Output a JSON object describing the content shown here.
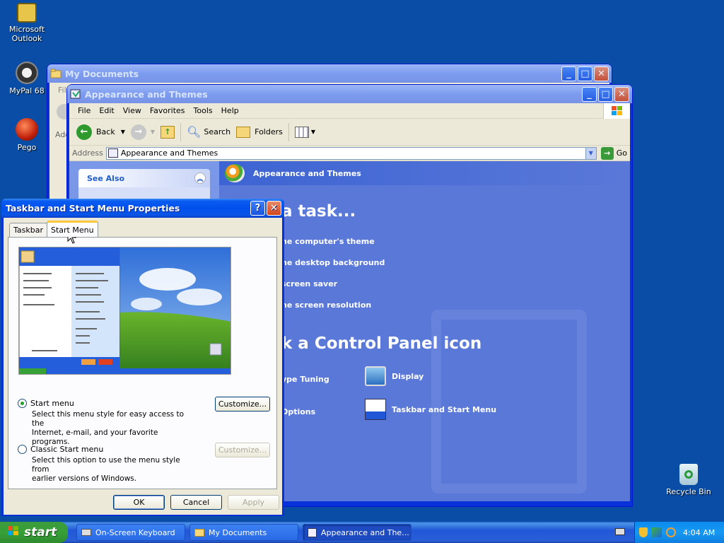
{
  "desktop": {
    "icons": [
      {
        "label_1": "Microsoft",
        "label_2": "Outlook"
      },
      {
        "label": "MyPal 68"
      },
      {
        "label": "Pego"
      },
      {
        "label": "Recycle Bin"
      }
    ]
  },
  "my_documents": {
    "title": "My Documents",
    "menu_partial": "File",
    "addr_partial": "Add"
  },
  "explorer": {
    "title": "Appearance and Themes",
    "menu": [
      "File",
      "Edit",
      "View",
      "Favorites",
      "Tools",
      "Help"
    ],
    "toolbar": {
      "back": "Back",
      "search": "Search",
      "folders": "Folders"
    },
    "address": {
      "label": "Address",
      "value": "Appearance and Themes",
      "go": "Go"
    },
    "see_also": "See Also",
    "header": "Appearance and Themes",
    "pick_task": "a task...",
    "tasks": [
      "he computer's theme",
      "he desktop background",
      " screen saver",
      "he screen resolution"
    ],
    "pick_icon": "k a Control Panel icon",
    "icons": [
      "ype Tuning",
      "Display",
      " Options",
      "Taskbar and Start Menu"
    ]
  },
  "dialog": {
    "title": "Taskbar and Start Menu Properties",
    "tabs": [
      "Taskbar",
      "Start Menu"
    ],
    "option1": {
      "label": "Start menu",
      "desc_1": "Select this menu style for easy access to the",
      "desc_2": "Internet, e-mail, and your favorite programs.",
      "button": "Customize...",
      "selected": true
    },
    "option2": {
      "label": "Classic Start menu",
      "desc_1": "Select this option to use the menu style from",
      "desc_2": "earlier versions of Windows.",
      "button": "Customize...",
      "selected": false
    },
    "buttons": {
      "ok": "OK",
      "cancel": "Cancel",
      "apply": "Apply"
    }
  },
  "taskbar": {
    "start": "start",
    "items": [
      "On-Screen Keyboard",
      "My Documents",
      "Appearance and The..."
    ],
    "clock": "4:04 AM"
  },
  "colors": {
    "desktop": "#0a4da6",
    "xp_blue": "#0831d9",
    "panel_blue": "#5a78d8",
    "start_green": "#37a037"
  }
}
